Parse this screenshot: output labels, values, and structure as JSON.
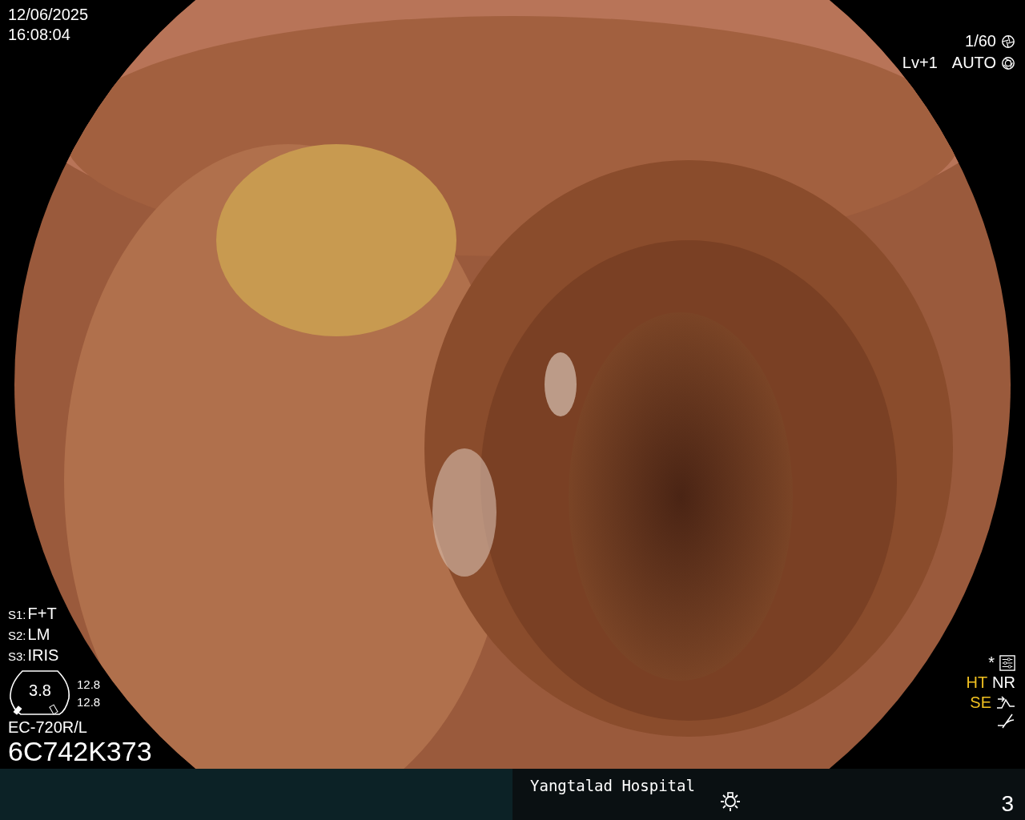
{
  "clock": {
    "date": "12/06/2025",
    "time": "16:08:04"
  },
  "exposure": {
    "shutter": "1/60",
    "level": "Lv+1",
    "iris_mode": "AUTO"
  },
  "switches": [
    {
      "key": "S1:",
      "value": "F+T"
    },
    {
      "key": "S2:",
      "value": "LM"
    },
    {
      "key": "S3:",
      "value": "IRIS"
    }
  ],
  "scope_gauge": {
    "reading": "3.8",
    "values": [
      "12.8",
      "12.8"
    ]
  },
  "scope": {
    "model": "EC-720R/L",
    "serial": "6C742K373"
  },
  "enhancement": {
    "marker": "*",
    "modes": [
      {
        "label": "HT",
        "color": "#f0c020"
      },
      {
        "label": "NR",
        "color": "#ffffff"
      },
      {
        "label": "SE",
        "color": "#f0c020"
      }
    ]
  },
  "status_bar": {
    "hospital": "Yangtalad Hospital",
    "page": "3"
  }
}
